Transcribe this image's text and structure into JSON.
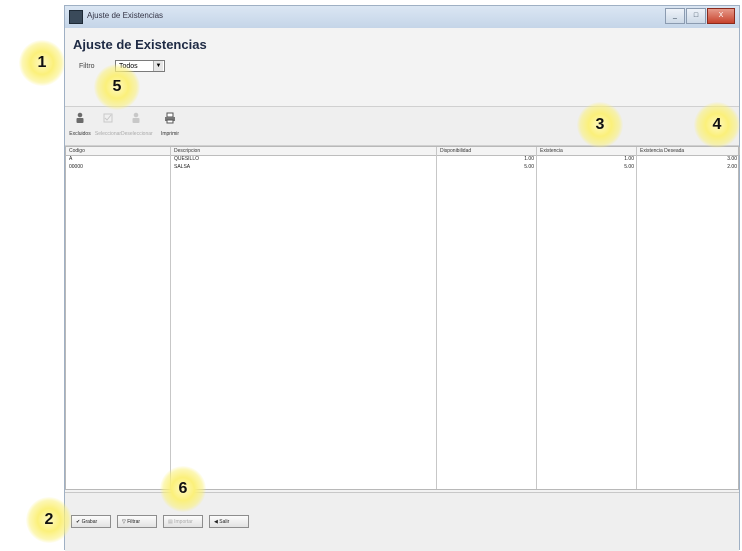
{
  "window": {
    "title": "Ajuste de Existencias",
    "controls": [
      "_",
      "□",
      "X"
    ]
  },
  "form": {
    "title": "Ajuste de Existencias",
    "filter_label": "Filtro",
    "filter_value": "Todos"
  },
  "toolbar": [
    {
      "icon": "person-icon",
      "label": "Excluidos",
      "enabled": true
    },
    {
      "icon": "select-icon",
      "label": "Seleccionar",
      "enabled": false
    },
    {
      "icon": "person-icon",
      "label": "Deseleccionar",
      "enabled": false
    },
    {
      "icon": "print-icon",
      "label": "Imprimir",
      "enabled": true
    }
  ],
  "table": {
    "columns": [
      "Codigo",
      "Descripcion",
      "Disponibilidad",
      "Existencia",
      "Existencia Deseada"
    ],
    "rows": [
      {
        "codigo": "A",
        "descripcion": "QUESILLO",
        "disponibilidad": "1.00",
        "existencia": "1.00",
        "existencia_deseada": "3.00"
      },
      {
        "codigo": "00000",
        "descripcion": "SALSA",
        "disponibilidad": "5.00",
        "existencia": "5.00",
        "existencia_deseada": "2.00"
      }
    ]
  },
  "bottom_buttons": [
    {
      "icon": "check-icon",
      "label": "Grabar",
      "enabled": true
    },
    {
      "icon": "filter-icon",
      "label": "Filtrar",
      "enabled": true
    },
    {
      "icon": "import-icon",
      "label": "Importar",
      "enabled": false
    },
    {
      "icon": "exit-icon",
      "label": "Salir",
      "enabled": true
    }
  ],
  "markers": [
    "1",
    "2",
    "3",
    "4",
    "5",
    "6"
  ]
}
